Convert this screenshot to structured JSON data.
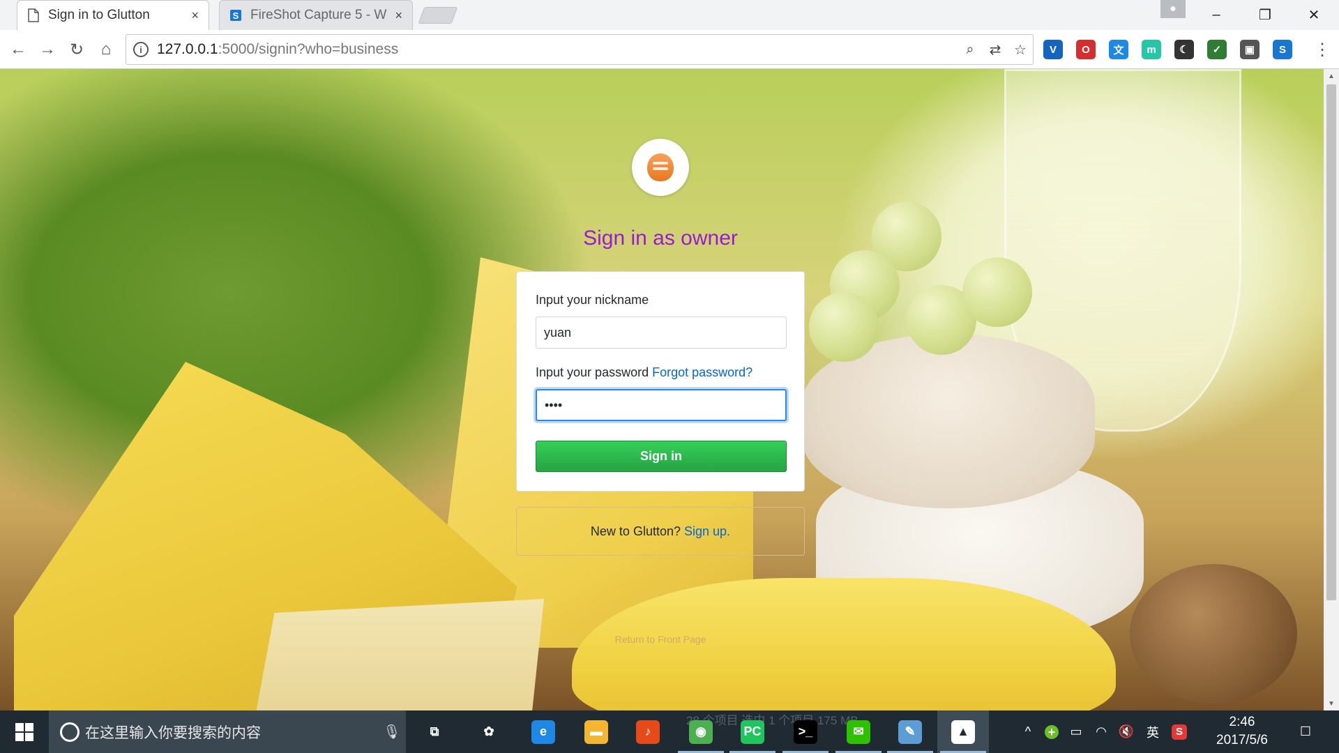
{
  "browser": {
    "tabs": [
      {
        "title": "Sign in to Glutton",
        "active": true
      },
      {
        "title": "FireShot Capture 5 - W",
        "active": false
      }
    ],
    "close_glyph": "×",
    "url_host": "127.0.0.1",
    "url_rest": ":5000/signin?who=business",
    "window_controls": {
      "minimize": "–",
      "restore": "❐",
      "close": "✕"
    },
    "extensions": [
      {
        "name": "v-extension-icon",
        "color": "#1565c0",
        "glyph": "V"
      },
      {
        "name": "opera-icon",
        "color": "#d32f2f",
        "glyph": "O"
      },
      {
        "name": "translate-extension-icon",
        "color": "#1e88e5",
        "glyph": "文"
      },
      {
        "name": "m-extension-icon",
        "color": "#26c6a6",
        "glyph": "m"
      },
      {
        "name": "dark-mode-icon",
        "color": "#333333",
        "glyph": "☾"
      },
      {
        "name": "shield-extension-icon",
        "color": "#2e7d32",
        "glyph": "✓"
      },
      {
        "name": "robot-extension-icon",
        "color": "#555555",
        "glyph": "▣"
      },
      {
        "name": "s-extension-icon",
        "color": "#1976d2",
        "glyph": "S"
      }
    ]
  },
  "page": {
    "heading": "Sign in as owner",
    "nickname_label": "Input your nickname",
    "nickname_value": "yuan",
    "password_label": "Input your password",
    "forgot_link": "Forgot password?",
    "password_value": "yuan",
    "signin_button": "Sign in",
    "signup_prompt": "New to Glutton?",
    "signup_link": "Sign up.",
    "return_link": "Return to Front Page"
  },
  "taskbar": {
    "search_placeholder": "在这里输入你要搜索的内容",
    "ghost_status": "28 个项目    选中 1 个项目  175 MB",
    "ime": "英",
    "time": "2:46",
    "date": "2017/5/6",
    "apps": [
      {
        "name": "task-view-icon",
        "glyph": "⧉",
        "color": "transparent"
      },
      {
        "name": "app-swirl-icon",
        "glyph": "✿",
        "color": "transparent"
      },
      {
        "name": "edge-icon",
        "glyph": "e",
        "color": "#1e88e5"
      },
      {
        "name": "file-explorer-icon",
        "glyph": "▬",
        "color": "#f2b632"
      },
      {
        "name": "music-app-icon",
        "glyph": "♪",
        "color": "#e64a19"
      },
      {
        "name": "chrome-icon",
        "glyph": "◉",
        "color": "#4caf50"
      },
      {
        "name": "pycharm-icon",
        "glyph": "PC",
        "color": "#21c55d"
      },
      {
        "name": "terminal-icon",
        "glyph": ">_",
        "color": "#000000"
      },
      {
        "name": "wechat-icon",
        "glyph": "✉",
        "color": "#2dc100"
      },
      {
        "name": "notepad-icon",
        "glyph": "✎",
        "color": "#5c9dd5"
      },
      {
        "name": "photos-icon",
        "glyph": "▲",
        "color": "#ffffff"
      }
    ]
  }
}
